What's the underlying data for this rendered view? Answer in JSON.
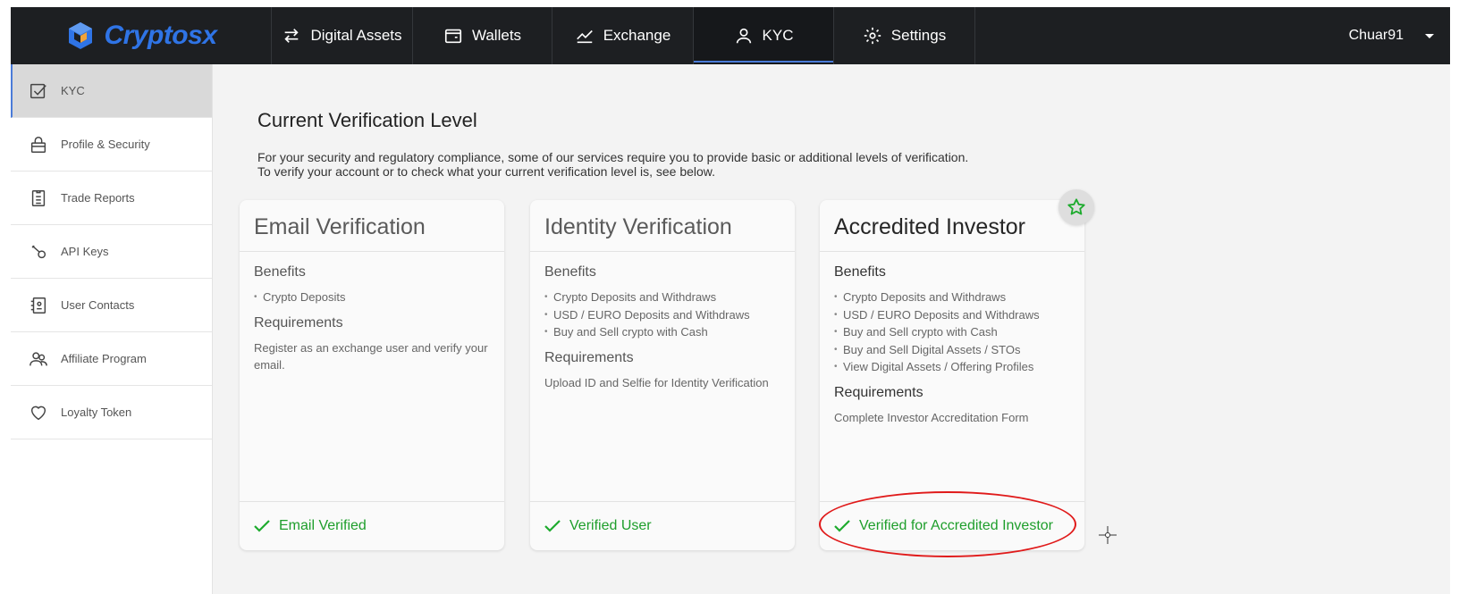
{
  "brand": {
    "name": "Cryptosx",
    "accent": "#2f74e6"
  },
  "nav": {
    "items": [
      {
        "label": "Digital Assets",
        "icon": "arrows-exchange-icon"
      },
      {
        "label": "Wallets",
        "icon": "wallet-icon"
      },
      {
        "label": "Exchange",
        "icon": "line-chart-icon"
      },
      {
        "label": "KYC",
        "icon": "user-icon",
        "active": true
      },
      {
        "label": "Settings",
        "icon": "gear-icon"
      }
    ],
    "username": "Chuar91"
  },
  "sidebar": {
    "items": [
      {
        "label": "KYC",
        "icon": "checkbox-icon",
        "active": true
      },
      {
        "label": "Profile & Security",
        "icon": "lock-icon"
      },
      {
        "label": "Trade Reports",
        "icon": "clipboard-icon"
      },
      {
        "label": "API Keys",
        "icon": "key-icon"
      },
      {
        "label": "User Contacts",
        "icon": "contacts-icon"
      },
      {
        "label": "Affiliate Program",
        "icon": "users-icon"
      },
      {
        "label": "Loyalty Token",
        "icon": "heart-icon"
      }
    ]
  },
  "main": {
    "title": "Current Verification Level",
    "intro_line1": "For your security and regulatory compliance, some of our services require you to provide basic or additional levels of verification.",
    "intro_line2": "To verify your account or to check what your current verification level is, see below.",
    "benefits_label": "Benefits",
    "requirements_label": "Requirements",
    "cards": [
      {
        "title": "Email Verification",
        "benefits": [
          "Crypto Deposits"
        ],
        "requirements": "Register as an exchange user and verify your email.",
        "status": "Email Verified"
      },
      {
        "title": "Identity Verification",
        "benefits": [
          "Crypto Deposits and Withdraws",
          "USD / EURO Deposits and Withdraws",
          "Buy and Sell crypto with Cash"
        ],
        "requirements": "Upload ID and Selfie for Identity Verification",
        "status": "Verified User"
      },
      {
        "title": "Accredited Investor",
        "benefits": [
          "Crypto Deposits and Withdraws",
          "USD / EURO Deposits and Withdraws",
          "Buy and Sell crypto with Cash",
          "Buy and Sell Digital Assets / STOs",
          "View Digital Assets / Offering Profiles"
        ],
        "requirements": "Complete Investor Accreditation Form",
        "status": "Verified for Accredited Investor",
        "badge_icon": "star-icon"
      }
    ],
    "status_color": "#1e9e2b",
    "highlight_color": "#e01a1a"
  }
}
